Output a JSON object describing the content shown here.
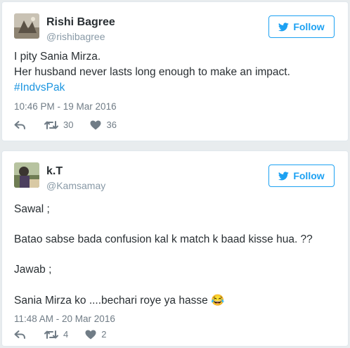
{
  "tweets": [
    {
      "name": "Rishi Bagree",
      "handle": "@rishibagree",
      "follow_label": "Follow",
      "lines": [
        "I pity Sania Mirza.",
        "Her husband never lasts long enough to make an impact."
      ],
      "hashtag": "#IndvsPak",
      "timestamp": "10:46 PM - 19 Mar 2016",
      "retweets": "30",
      "likes": "36"
    },
    {
      "name": "k.T",
      "handle": "@Kamsamay",
      "follow_label": "Follow",
      "lines": [
        "Sawal ;",
        "Batao sabse bada confusion kal k match k baad kisse hua. ??",
        "Jawab ;",
        "Sania Mirza ko ....bechari roye ya hasse"
      ],
      "emoji": "😂",
      "timestamp": "11:48 AM - 20 Mar 2016",
      "retweets": "4",
      "likes": "2"
    }
  ],
  "colors": {
    "accent": "#1da1f2",
    "hashtag": "#1b95e0",
    "muted": "#8899a6",
    "text": "#292f33"
  },
  "icons": [
    "twitter-bird-icon",
    "reply-icon",
    "retweet-icon",
    "heart-icon"
  ]
}
